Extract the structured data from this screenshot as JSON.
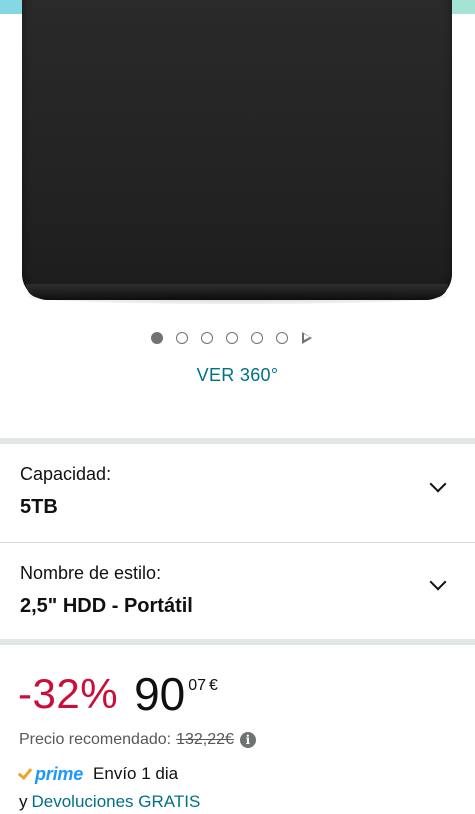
{
  "gallery": {
    "image_alt": "Disco duro externo negro",
    "dot_count": 6,
    "active_dot": 0,
    "ver360_label": "VER 360°"
  },
  "selectors": [
    {
      "label": "Capacidad:",
      "value": "5TB"
    },
    {
      "label": "Nombre de estilo:",
      "value": "2,5\" HDD - Portátil"
    }
  ],
  "price": {
    "discount": "-32%",
    "whole": "90",
    "fraction": "07",
    "currency": "€",
    "rrp_label": "Precio recomendado:",
    "rrp_value": "132,22€",
    "info_icon": "info-icon"
  },
  "delivery": {
    "prime_label": "prime",
    "text": "Envío 1 dia",
    "returns_prefix": "y",
    "returns_link": "Devoluciones GRATIS"
  },
  "colors": {
    "link": "#007185",
    "discount": "#cc0c39",
    "prime_blue": "#1a98ff",
    "prime_check": "#f0a32f"
  }
}
